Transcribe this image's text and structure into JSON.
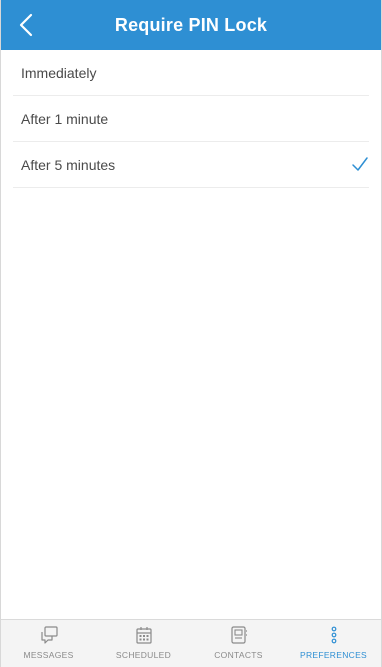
{
  "header": {
    "title": "Require PIN Lock",
    "back_icon": "chevron-left-icon"
  },
  "options": [
    {
      "label": "Immediately",
      "selected": false
    },
    {
      "label": "After 1 minute",
      "selected": false
    },
    {
      "label": "After 5 minutes",
      "selected": true
    }
  ],
  "tabs": [
    {
      "label": "MESSAGES",
      "icon": "messages-icon",
      "active": false
    },
    {
      "label": "SCHEDULED",
      "icon": "calendar-icon",
      "active": false
    },
    {
      "label": "CONTACTS",
      "icon": "contacts-icon",
      "active": false
    },
    {
      "label": "PREFERENCES",
      "icon": "more-vertical-icon",
      "active": true
    }
  ],
  "colors": {
    "accent": "#2e8fd3",
    "text": "#4a4a4a",
    "tab_inactive": "#8a8a8a",
    "tabbar_bg": "#f4f4f4"
  }
}
